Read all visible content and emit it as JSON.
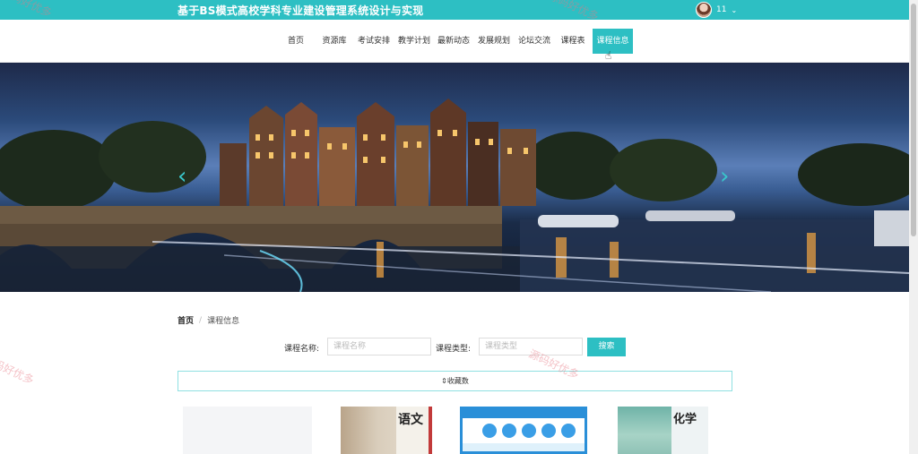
{
  "header": {
    "site_title": "基于BS模式高校学科专业建设管理系统设计与实现",
    "username": "11"
  },
  "nav": {
    "items": [
      {
        "label": "首页",
        "name": "nav-home"
      },
      {
        "label": "资源库",
        "name": "nav-resources"
      },
      {
        "label": "考试安排",
        "name": "nav-exams"
      },
      {
        "label": "教学计划",
        "name": "nav-teaching-plan"
      },
      {
        "label": "最新动态",
        "name": "nav-news"
      },
      {
        "label": "发展规划",
        "name": "nav-development"
      },
      {
        "label": "论坛交流",
        "name": "nav-forum"
      },
      {
        "label": "课程表",
        "name": "nav-timetable"
      },
      {
        "label": "课程信息",
        "name": "nav-course-info"
      }
    ],
    "active": "课程信息"
  },
  "breadcrumb": {
    "home": "首页",
    "separator": "/",
    "current": "课程信息"
  },
  "search": {
    "course_name_label": "课程名称:",
    "course_name_placeholder": "课程名称",
    "course_type_label": "课程类型:",
    "course_type_placeholder": "课程类型",
    "button": "搜索"
  },
  "sort": {
    "label": "⇕收藏数"
  },
  "cards": [
    {
      "name": "course-card-1",
      "title": ""
    },
    {
      "name": "course-card-2",
      "title": "语文"
    },
    {
      "name": "course-card-3",
      "title": ""
    },
    {
      "name": "course-card-4",
      "title": "化学"
    }
  ],
  "watermark": "源码好优多",
  "colors": {
    "accent": "#2dbfc3",
    "watermark": "#e67882"
  },
  "icons": {
    "carousel_prev": "chevron-left-icon",
    "carousel_next": "chevron-right-icon",
    "user_menu": "chevron-down-icon",
    "cursor": "pointer-hand-icon"
  }
}
